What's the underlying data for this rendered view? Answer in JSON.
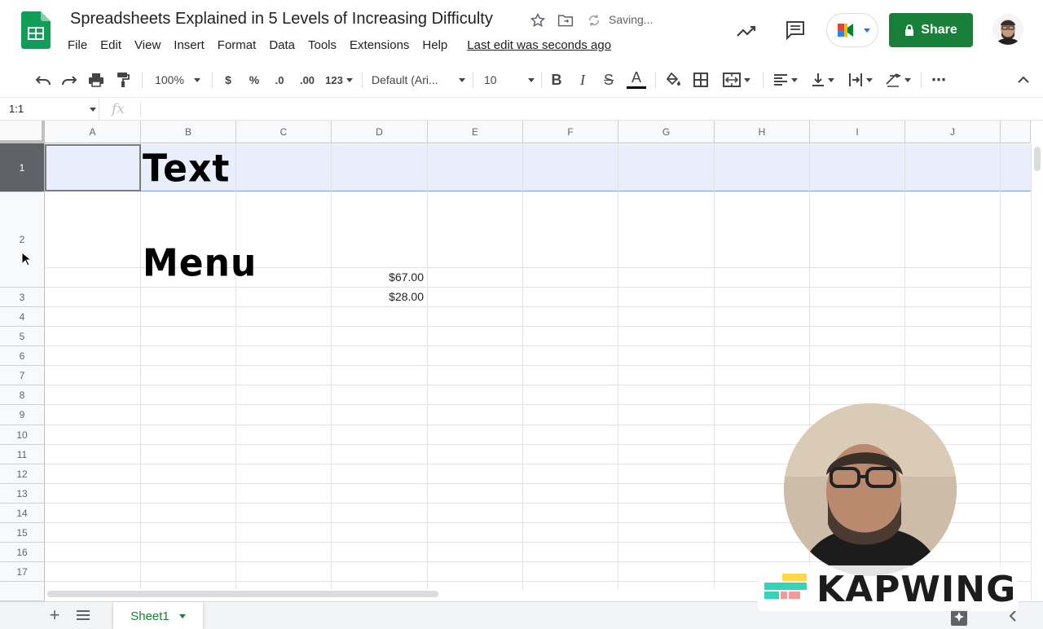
{
  "document": {
    "title": "Spreadsheets Explained in 5 Levels of Increasing Difficulty",
    "saving_status": "Saving...",
    "last_edit": "Last edit was seconds ago"
  },
  "menu": [
    "File",
    "Edit",
    "View",
    "Insert",
    "Format",
    "Data",
    "Tools",
    "Extensions",
    "Help"
  ],
  "header_actions": {
    "share_label": "Share"
  },
  "toolbar": {
    "zoom": "100%",
    "currency": "$",
    "percent": "%",
    "decrease_decimals": ".0",
    "increase_decimals": ".00",
    "more_formats": "123",
    "font_family": "Default (Ari...",
    "font_size": "10",
    "bold": "B",
    "italic": "I",
    "strikethrough": "S",
    "text_color": "A",
    "more": "⋯"
  },
  "formula_bar": {
    "name_box": "1:1",
    "fx_label": "fx",
    "formula": ""
  },
  "grid": {
    "columns": [
      "A",
      "B",
      "C",
      "D",
      "E",
      "F",
      "G",
      "H",
      "I",
      "J"
    ],
    "rows": [
      "1",
      "2",
      "3",
      "4",
      "5",
      "6",
      "7",
      "8",
      "9",
      "10",
      "11",
      "12",
      "13",
      "14",
      "15",
      "16",
      "17"
    ],
    "selected_row": "1",
    "cells": {
      "B1": "Text",
      "B2": "Menu",
      "D2": "$67.00",
      "D3": "$28.00"
    }
  },
  "sheets": {
    "tabs": [
      "Sheet1"
    ],
    "active": "Sheet1"
  },
  "colors": {
    "share_green": "#188038",
    "selection_fill": "#e8eefb",
    "row_header_selected": "#5f6368"
  },
  "watermark": {
    "text": "KAPWING"
  }
}
